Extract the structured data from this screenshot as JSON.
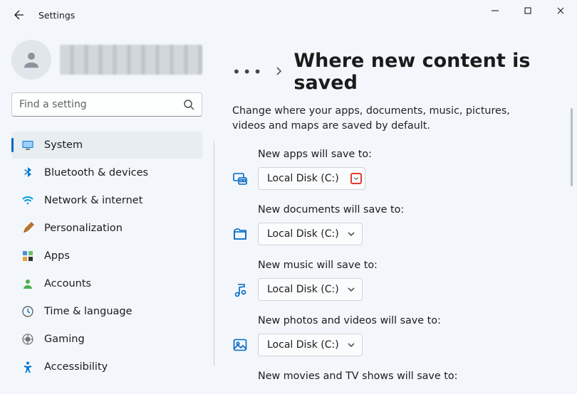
{
  "app": {
    "title": "Settings"
  },
  "search": {
    "placeholder": "Find a setting"
  },
  "sidebar": {
    "items": [
      {
        "label": "System"
      },
      {
        "label": "Bluetooth & devices"
      },
      {
        "label": "Network & internet"
      },
      {
        "label": "Personalization"
      },
      {
        "label": "Apps"
      },
      {
        "label": "Accounts"
      },
      {
        "label": "Time & language"
      },
      {
        "label": "Gaming"
      },
      {
        "label": "Accessibility"
      }
    ]
  },
  "breadcrumb": {
    "title": "Where new content is saved"
  },
  "description": "Change where your apps, documents, music, pictures, videos and maps are saved by default.",
  "settings": {
    "apps": {
      "label": "New apps will save to:",
      "value": "Local Disk (C:)"
    },
    "documents": {
      "label": "New documents will save to:",
      "value": "Local Disk (C:)"
    },
    "music": {
      "label": "New music will save to:",
      "value": "Local Disk (C:)"
    },
    "photos": {
      "label": "New photos and videos will save to:",
      "value": "Local Disk (C:)"
    },
    "movies": {
      "label": "New movies and TV shows will save to:"
    }
  }
}
